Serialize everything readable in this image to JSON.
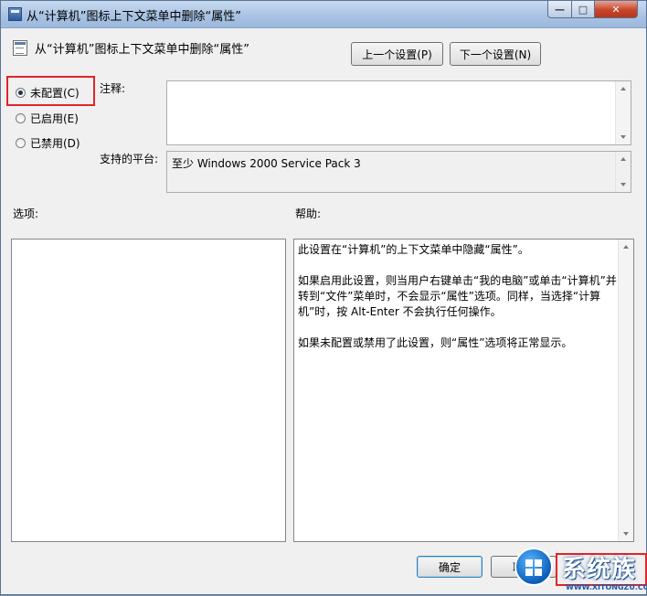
{
  "window": {
    "title": "从“计算机”图标上下文菜单中删除“属性”",
    "controls": {
      "minimize": "—",
      "maximize": "□",
      "close": "✕"
    }
  },
  "header": {
    "title": "从“计算机”图标上下文菜单中删除“属性”",
    "prev_button": "上一个设置(P)",
    "next_button": "下一个设置(N)"
  },
  "state_options": [
    {
      "label": "未配置(C)",
      "selected": true
    },
    {
      "label": "已启用(E)",
      "selected": false
    },
    {
      "label": "已禁用(D)",
      "selected": false
    }
  ],
  "comment": {
    "label": "注释:",
    "value": ""
  },
  "platform": {
    "label": "支持的平台:",
    "value": "至少 Windows 2000 Service Pack 3"
  },
  "options_panel": {
    "label": "选项:"
  },
  "help_panel": {
    "label": "帮助:",
    "paragraphs": [
      "此设置在“计算机”的上下文菜单中隐藏“属性”。",
      "如果启用此设置，则当用户右键单击“我的电脑”或单击“计算机”并转到“文件”菜单时，不会显示“属性”选项。同样，当选择“计算机”时，按 Alt-Enter 不会执行任何操作。",
      "如果未配置或禁用了此设置，则“属性”选项将正常显示。"
    ]
  },
  "footer": {
    "ok_button": "确定",
    "cancel_button": "取消"
  },
  "watermark": {
    "text": "系统族",
    "url": "WWW.XITONGZU.COM"
  },
  "colors": {
    "highlight": "#e0242b",
    "title_bar": "#a9c3e3",
    "close_button": "#c8452c"
  }
}
